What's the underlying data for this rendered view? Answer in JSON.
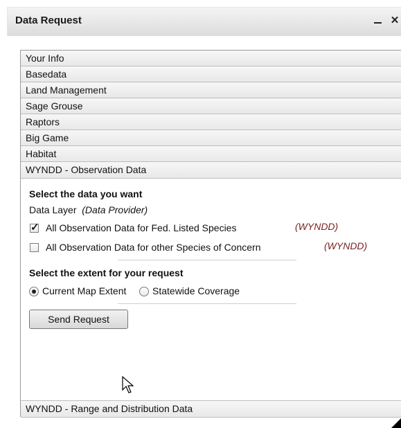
{
  "window": {
    "title": "Data Request"
  },
  "titlebar": {
    "minimize_label": "–",
    "close_label": "×"
  },
  "accordion": {
    "sections": [
      "Your Info",
      "Basedata",
      "Land Management",
      "Sage Grouse",
      "Raptors",
      "Big Game",
      "Habitat",
      "WYNDD - Observation Data"
    ],
    "last_section": "WYNDD - Range and Distribution Data"
  },
  "content": {
    "select_heading": "Select the data you want",
    "data_layer_label": "Data Layer",
    "data_provider_label": "(Data Provider)",
    "options": [
      {
        "label": "All Observation Data for Fed. Listed Species",
        "provider": "(WYNDD)",
        "checked": true
      },
      {
        "label": "All Observation Data for other Species of Concern",
        "provider": "(WYNDD)",
        "checked": false
      }
    ],
    "extent_heading": "Select the extent for your request",
    "extent_options": [
      {
        "label": "Current Map Extent",
        "selected": true
      },
      {
        "label": "Statewide Coverage",
        "selected": false
      }
    ],
    "send_button": "Send Request"
  },
  "colors": {
    "provider": "#7a1f1f",
    "titlebar": "#dcdcdc"
  },
  "icons": {
    "cursor": "arrow-pointer-icon",
    "check": "checkmark-icon"
  }
}
